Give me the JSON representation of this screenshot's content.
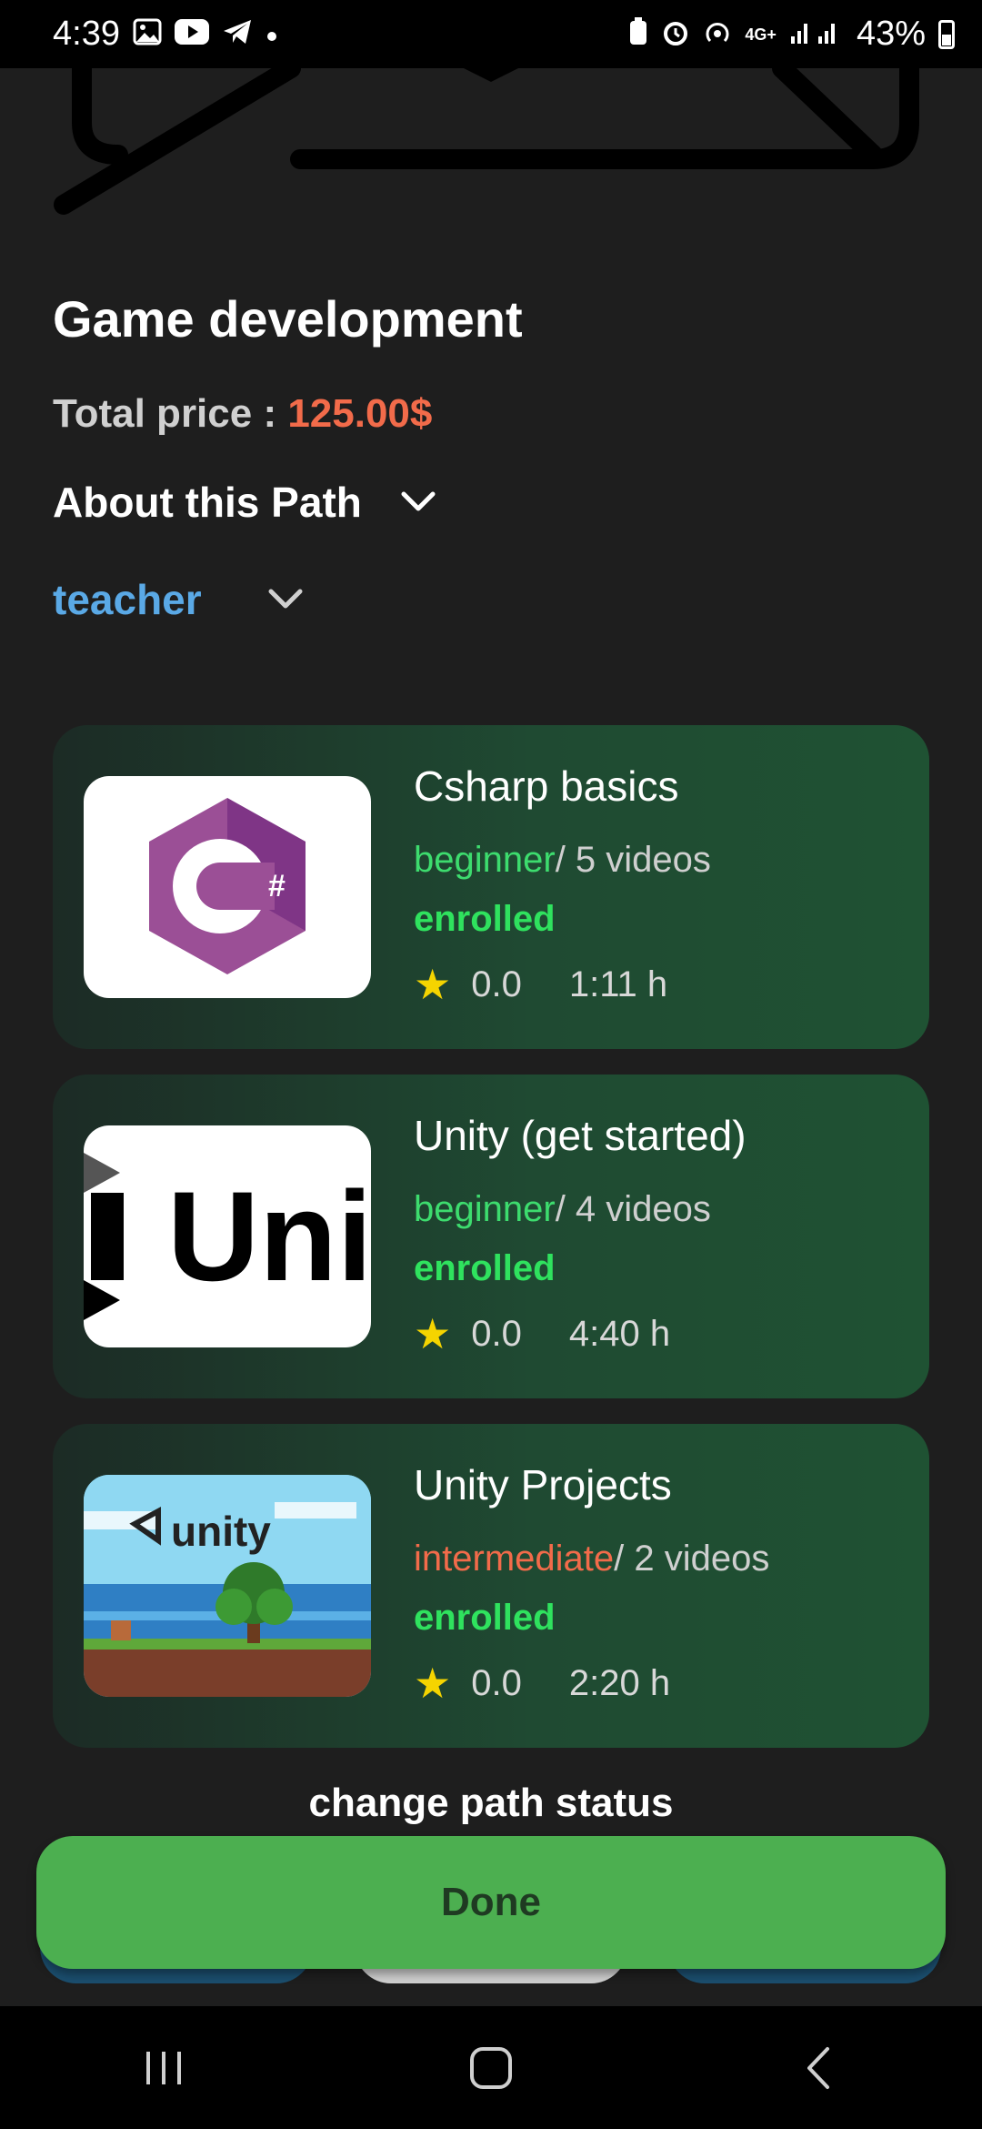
{
  "status_bar": {
    "time": "4:39",
    "network": "4G+",
    "battery": "43%"
  },
  "path": {
    "title": "Game development",
    "price_label": "Total price : ",
    "price_value": "125.00$",
    "about_label": "About this Path",
    "teacher_label": "teacher"
  },
  "courses": [
    {
      "title": "Csharp basics",
      "level": "beginner",
      "videos": "/ 5 videos",
      "status": "enrolled",
      "rating": "0.0",
      "duration": "1:11 h",
      "thumb_icon": "csharp-logo"
    },
    {
      "title": "Unity (get started)",
      "level": "beginner",
      "videos": "/ 4 videos",
      "status": "enrolled",
      "rating": "0.0",
      "duration": "4:40 h",
      "thumb_text": "Uni",
      "thumb_icon": "unity-wordmark"
    },
    {
      "title": "Unity Projects",
      "level": "intermediate",
      "videos": "/ 2 videos",
      "status": "enrolled",
      "rating": "0.0",
      "duration": "2:20 h",
      "thumb_text": "unity",
      "thumb_icon": "unity-pixel-art"
    }
  ],
  "footer": {
    "change_status_label": "change path status",
    "done_label": "Done"
  },
  "colors": {
    "background": "#1e1e1e",
    "price": "#f26b4a",
    "teacher": "#5aa9e6",
    "beginner": "#3ddc6e",
    "intermediate": "#f26b4a",
    "enrolled": "#2fe25e",
    "done_button": "#4caf50"
  }
}
